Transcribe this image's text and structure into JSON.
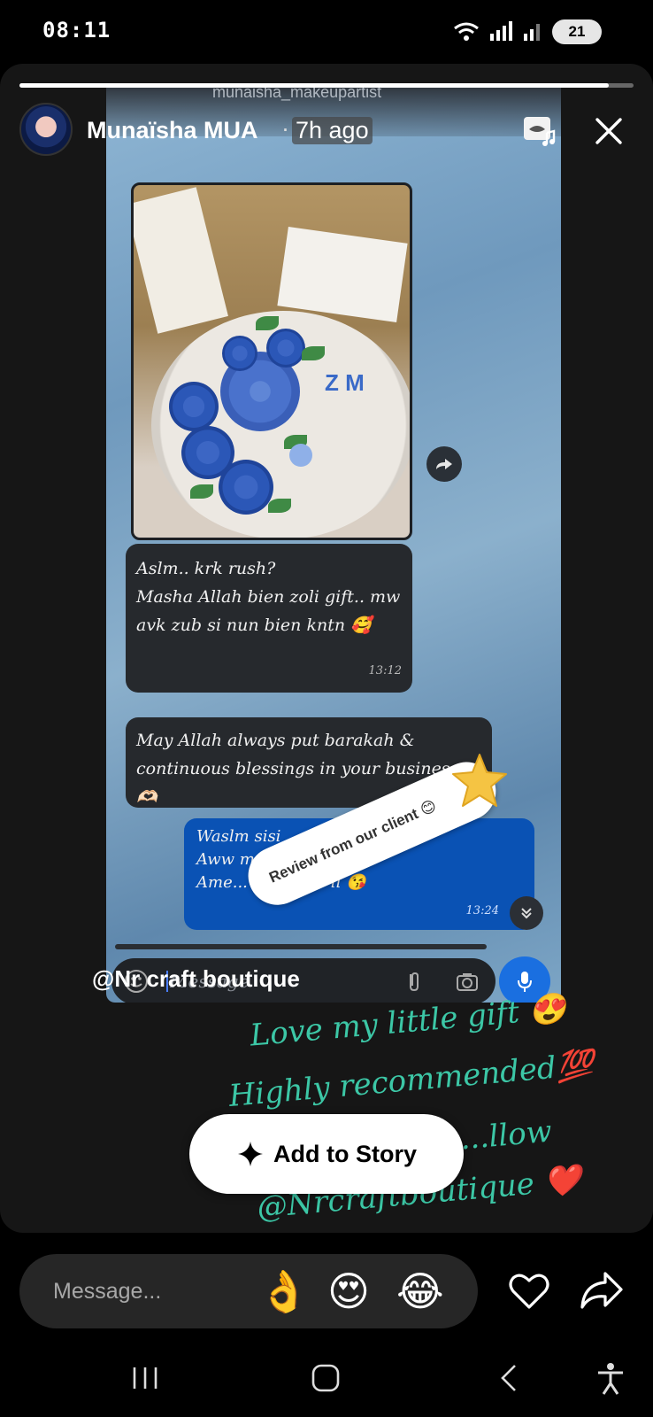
{
  "status_bar": {
    "time": "08:11",
    "battery": "21"
  },
  "story": {
    "progress": 0.96,
    "username": "Munaïsha MUA",
    "separator": "·",
    "time_ago": "7h ago"
  },
  "chat": {
    "contact_name": "munaisha_makeupartist",
    "messages": [
      {
        "text": "Aslm.. krk rush?\nMasha Allah bien zoli gift.. mw\navk zub si nun bien kntn 🥰",
        "time": "13:12"
      },
      {
        "text": "May Allah always put barakah &\ncontinuous blessings in your business. 🫶🏻",
        "time": ""
      },
      {
        "text": "Waslm sisi\nAww merci b...\nAme... ...en love li 😘",
        "time": "13:24"
      }
    ],
    "message_placeholder": "Message"
  },
  "sticker": {
    "text": "Review from our client 😊"
  },
  "overlay": {
    "mention": "@Nr craft boutique",
    "script_lines": [
      "Love my little gift 😍",
      "Highly recommended💯",
      "...llow",
      "@Nrcraftboutique ❤️"
    ]
  },
  "add_to_story": {
    "label": "Add to Story"
  },
  "reply": {
    "placeholder": "Message...",
    "quick_reactions": [
      "👌",
      "😍",
      "😂"
    ]
  },
  "colors": {
    "accent_blue": "#0a52b4",
    "script_green": "#3cc7a6"
  }
}
